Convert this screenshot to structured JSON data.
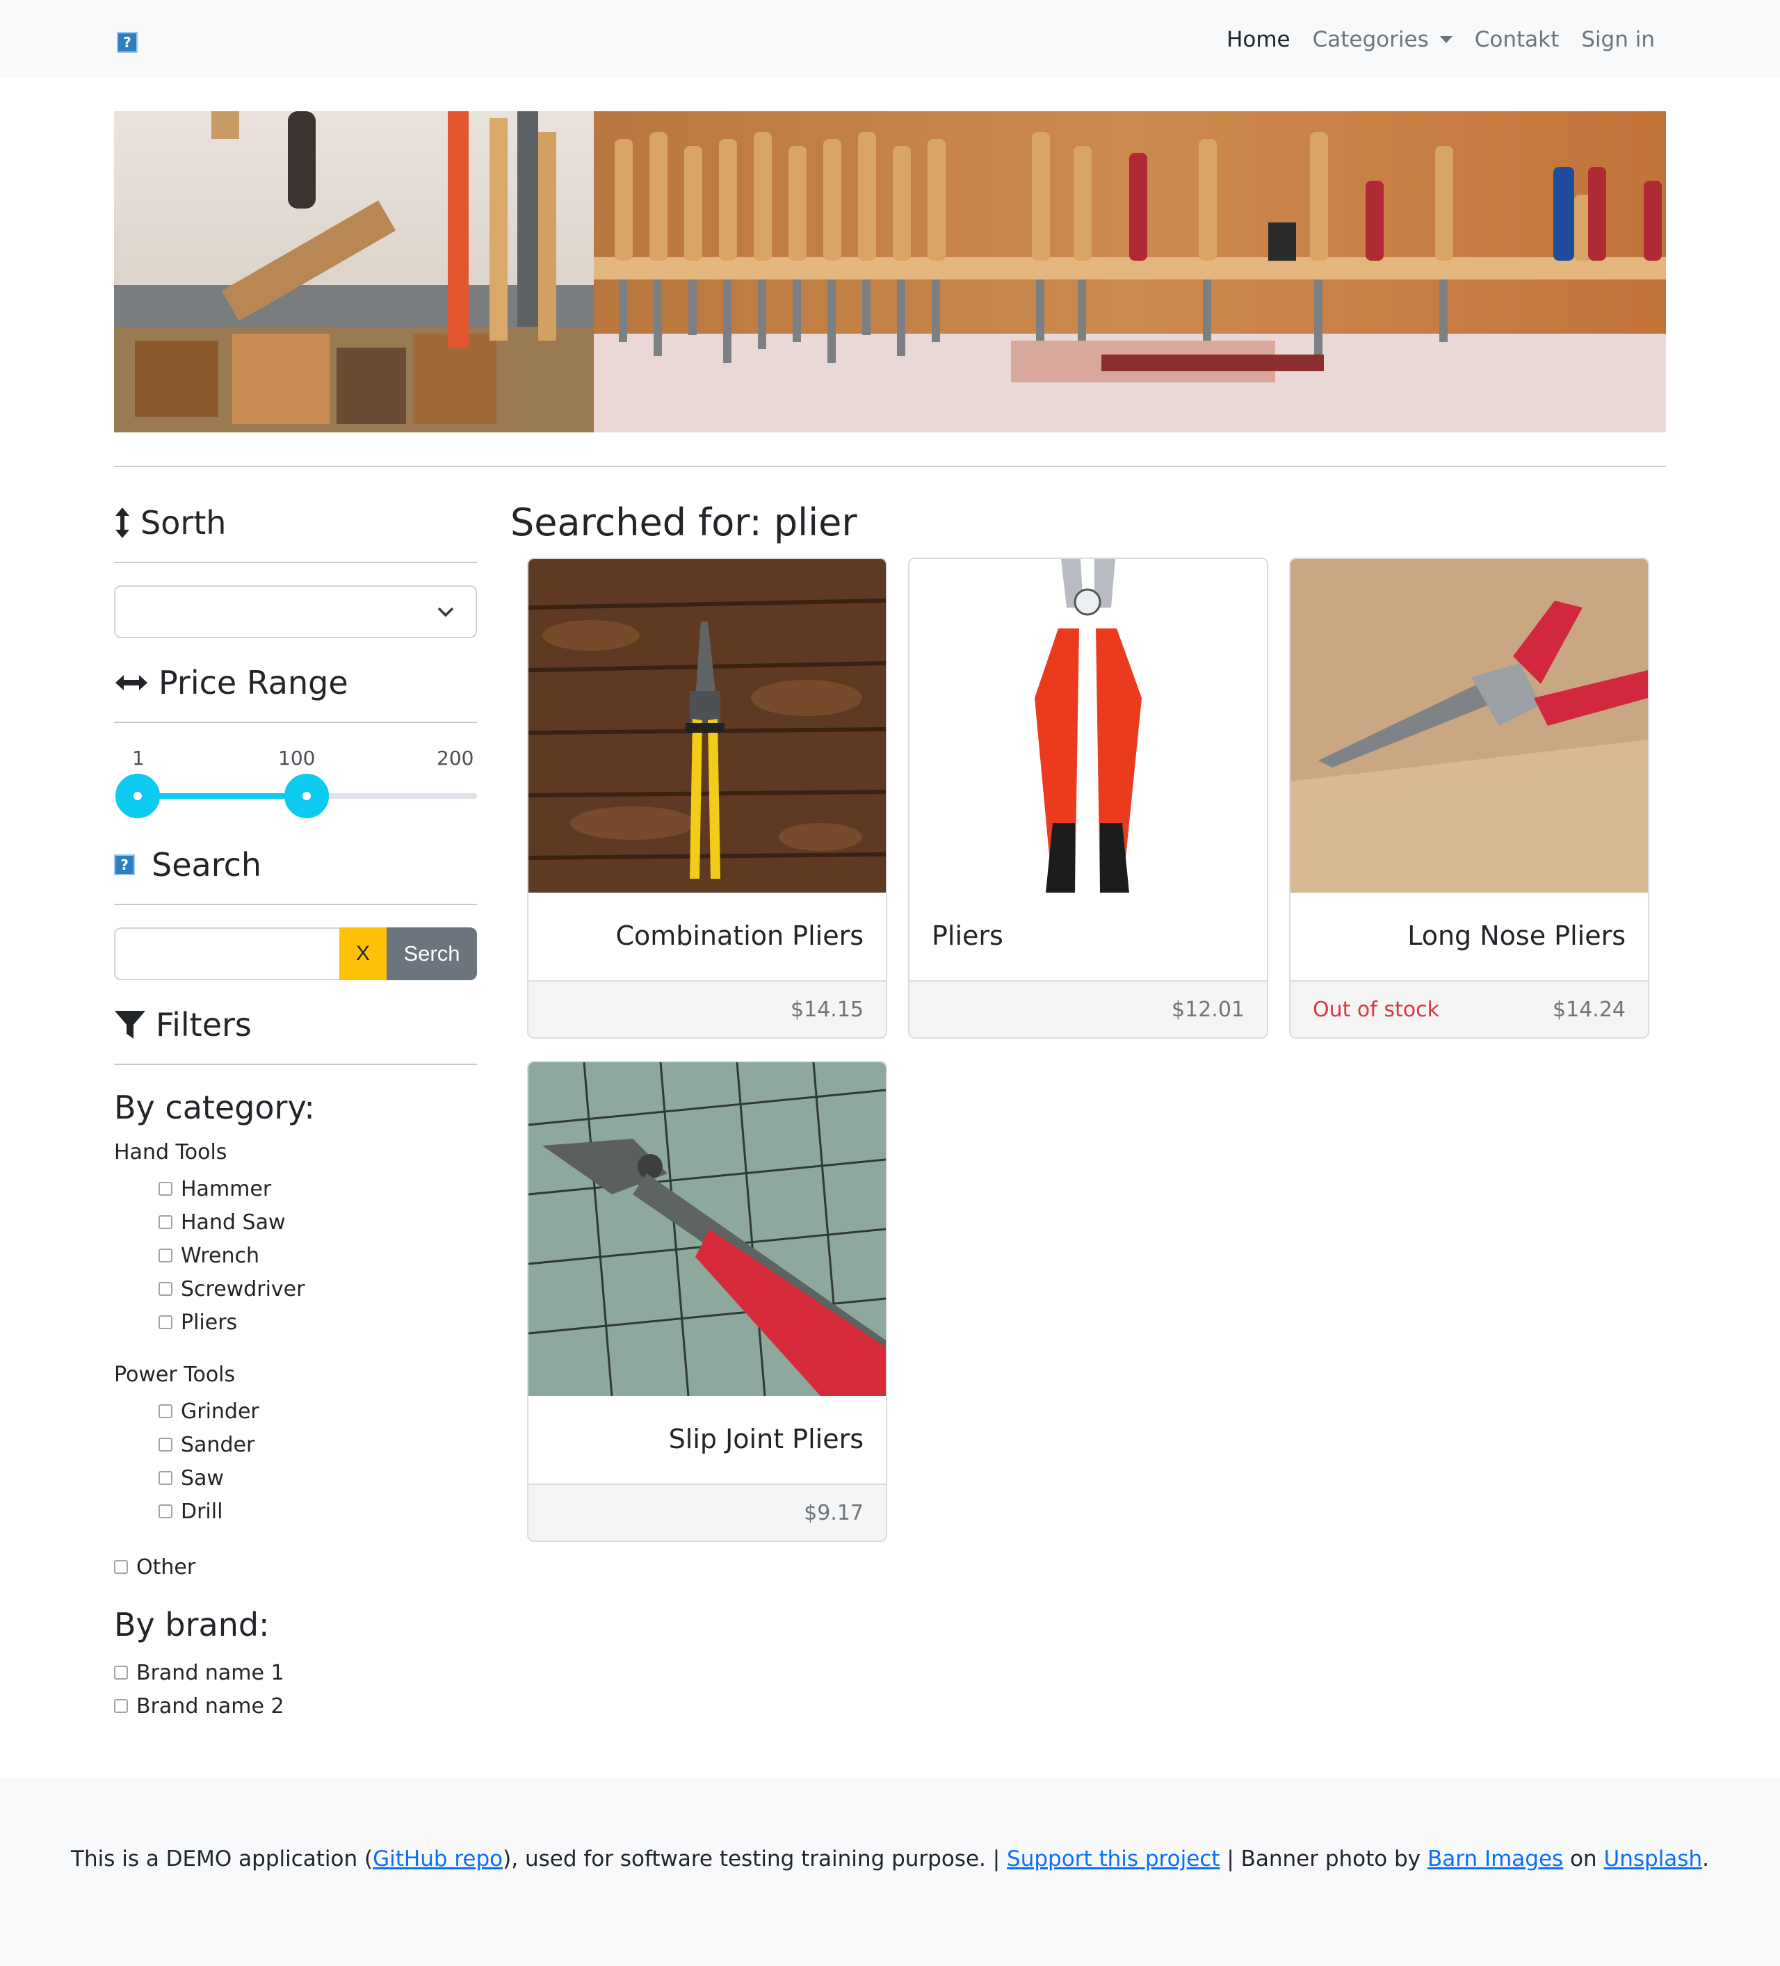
{
  "navbar": {
    "brand_icon": "broken-image-icon",
    "links": {
      "home": "Home",
      "categories": "Categories",
      "contact": "Contakt",
      "sign_in": "Sign in"
    }
  },
  "sidebar": {
    "sort": {
      "heading": "Sorth",
      "icon": "sort-vertical-icon",
      "selected": ""
    },
    "price_range": {
      "heading": "Price Range",
      "icon": "arrows-horizontal-icon",
      "min": "1",
      "current": "100",
      "max": "200",
      "min_value": 1,
      "current_value": 100,
      "max_value": 200
    },
    "search": {
      "heading": "Search",
      "icon": "broken-image-icon",
      "value": "",
      "clear_label": "X",
      "submit_label": "Serch"
    },
    "filters": {
      "heading": "Filters",
      "icon": "funnel-icon",
      "by_category": "By category:",
      "groups": [
        {
          "name": "Hand Tools",
          "items": [
            "Hammer",
            "Hand Saw",
            "Wrench",
            "Screwdriver",
            "Pliers"
          ]
        },
        {
          "name": "Power Tools",
          "items": [
            "Grinder",
            "Sander",
            "Saw",
            "Drill"
          ]
        }
      ],
      "other": "Other",
      "by_brand": "By brand:",
      "brands": [
        "Brand name 1",
        "Brand name 2"
      ]
    }
  },
  "main": {
    "heading": "Searched for: plier",
    "products": [
      {
        "name": "Combination Pliers",
        "price": "$14.15",
        "stock": ""
      },
      {
        "name": "Pliers",
        "price": "$12.01",
        "stock": ""
      },
      {
        "name": "Long Nose Pliers",
        "price": "$14.24",
        "stock": "Out of stock"
      },
      {
        "name": "Slip Joint Pliers",
        "price": "$9.17",
        "stock": ""
      }
    ]
  },
  "footer": {
    "prefix": "This is a DEMO application (",
    "github_link": "GitHub repo",
    "middle": "), used for software testing training purpose. | ",
    "support_link": "Support this project",
    "banner_text": " | Banner photo by ",
    "barn_link": "Barn Images",
    "on_text": " on ",
    "unsplash_link": "Unsplash",
    "suffix": "."
  },
  "colors": {
    "accent": "#0dcaf0",
    "warning": "#ffc107",
    "secondary": "#6c757d",
    "danger": "#dc3545",
    "link": "#0d6efd"
  }
}
